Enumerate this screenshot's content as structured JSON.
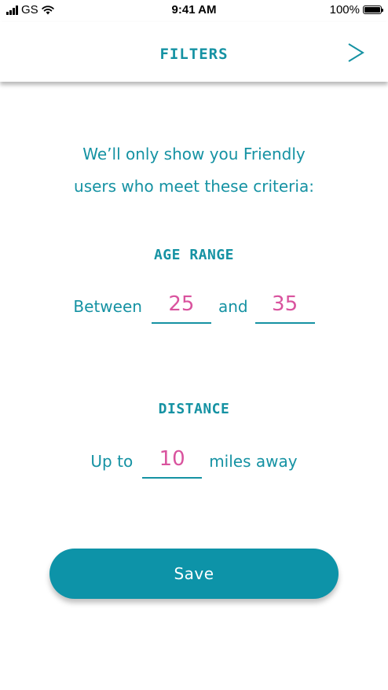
{
  "status_bar": {
    "carrier": "GS",
    "time": "9:41 AM",
    "battery": "100%",
    "icons": [
      "signal-icon",
      "wifi-icon",
      "battery-icon"
    ]
  },
  "header": {
    "title": "FILTERS",
    "next_icon": "chevron-right-icon"
  },
  "intro": {
    "line1": "We’ll only show you  Friendly",
    "line2": "users who meet these criteria:"
  },
  "age_range": {
    "title": "AGE RANGE",
    "between_label": "Between",
    "min_value": "25",
    "and_label": "and",
    "max_value": "35"
  },
  "distance": {
    "title": "DISTANCE",
    "prefix_label": "Up to",
    "value": "10",
    "suffix_label": "miles away"
  },
  "save_button": {
    "label": "Save"
  },
  "colors": {
    "accent": "#1592a3",
    "value": "#d9539e",
    "button": "#0d93a8"
  }
}
